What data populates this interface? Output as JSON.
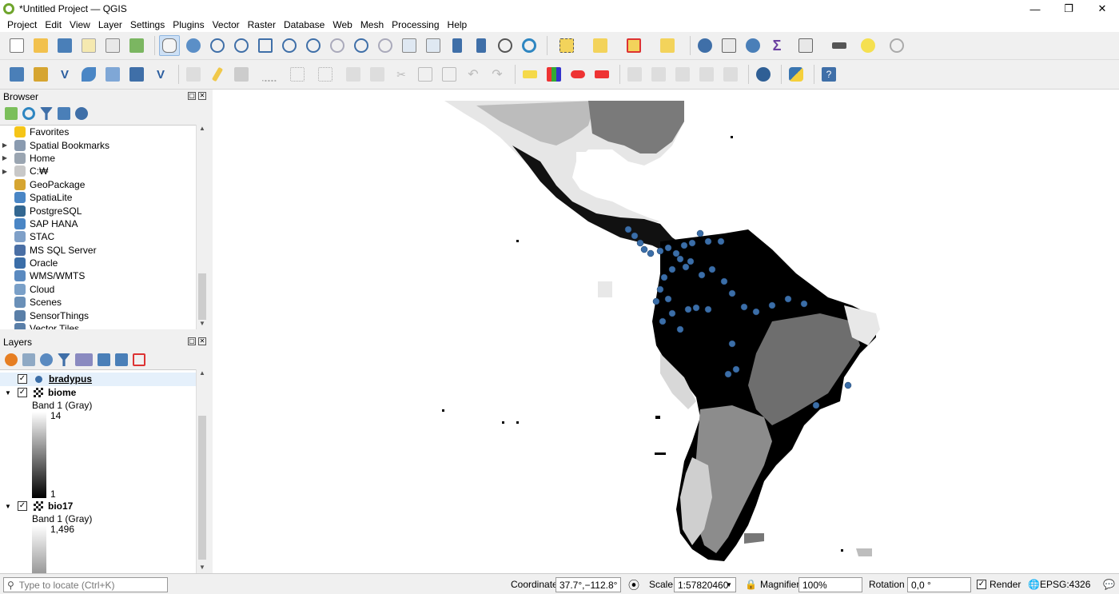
{
  "window": {
    "title": "*Untitled Project — QGIS",
    "minimize": "—",
    "restore": "❐",
    "close": "✕"
  },
  "menu": [
    "Project",
    "Edit",
    "View",
    "Layer",
    "Settings",
    "Plugins",
    "Vector",
    "Raster",
    "Database",
    "Web",
    "Mesh",
    "Processing",
    "Help"
  ],
  "browser": {
    "title": "Browser",
    "items": [
      {
        "label": "Favorites",
        "icon": "star-icon",
        "color": "#f5c518",
        "expand": ""
      },
      {
        "label": "Spatial Bookmarks",
        "icon": "bookmark-icon",
        "color": "#8a9bb0",
        "expand": "▶"
      },
      {
        "label": "Home",
        "icon": "home-icon",
        "color": "#9aa5b1",
        "expand": "▶"
      },
      {
        "label": "C:₩",
        "icon": "folder-icon",
        "color": "#c8c8c8",
        "expand": "▶"
      },
      {
        "label": "GeoPackage",
        "icon": "geopackage-icon",
        "color": "#d6a531",
        "expand": ""
      },
      {
        "label": "SpatiaLite",
        "icon": "spatialite-icon",
        "color": "#4a86c5",
        "expand": ""
      },
      {
        "label": "PostgreSQL",
        "icon": "postgresql-icon",
        "color": "#336791",
        "expand": ""
      },
      {
        "label": "SAP HANA",
        "icon": "sap-hana-icon",
        "color": "#4a86c5",
        "expand": ""
      },
      {
        "label": "STAC",
        "icon": "stac-icon",
        "color": "#7fa0c8",
        "expand": ""
      },
      {
        "label": "MS SQL Server",
        "icon": "mssql-icon",
        "color": "#4a6fa5",
        "expand": ""
      },
      {
        "label": "Oracle",
        "icon": "oracle-icon",
        "color": "#3b6ea8",
        "expand": ""
      },
      {
        "label": "WMS/WMTS",
        "icon": "wms-icon",
        "color": "#5a8ac0",
        "expand": ""
      },
      {
        "label": "Cloud",
        "icon": "cloud-icon",
        "color": "#7aa0c8",
        "expand": ""
      },
      {
        "label": "Scenes",
        "icon": "scenes-icon",
        "color": "#6a90b8",
        "expand": ""
      },
      {
        "label": "SensorThings",
        "icon": "sensor-icon",
        "color": "#5a7fa8",
        "expand": ""
      },
      {
        "label": "Vector Tiles",
        "icon": "vector-tiles-icon",
        "color": "#5a7fa8",
        "expand": ""
      }
    ]
  },
  "layers": {
    "title": "Layers",
    "items": [
      {
        "name": "bradypus",
        "checked": "✓",
        "expand": "",
        "kind": "point"
      },
      {
        "name": "biome",
        "checked": "✓",
        "expand": "▼",
        "band": "Band 1 (Gray)",
        "max": "14",
        "min": "1"
      },
      {
        "name": "bio17",
        "checked": "✓",
        "expand": "▼",
        "band": "Band 1 (Gray)",
        "max": "1,496"
      }
    ]
  },
  "status": {
    "locate_placeholder": "Type to locate (Ctrl+K)",
    "coordinate_label": "Coordinate",
    "coordinate_value": "37.7°,−112.8°",
    "scale_label": "Scale",
    "scale_value": "1:57820460",
    "magnifier_label": "Magnifier",
    "magnifier_value": "100%",
    "rotation_label": "Rotation",
    "rotation_value": "0,0 °",
    "render_label": "Render",
    "render_checked": "✓",
    "crs": "EPSG:4326"
  },
  "colors": {
    "point": "#3b6ea8",
    "map_bg": "#ffffff",
    "accent": "#cde0f5"
  }
}
